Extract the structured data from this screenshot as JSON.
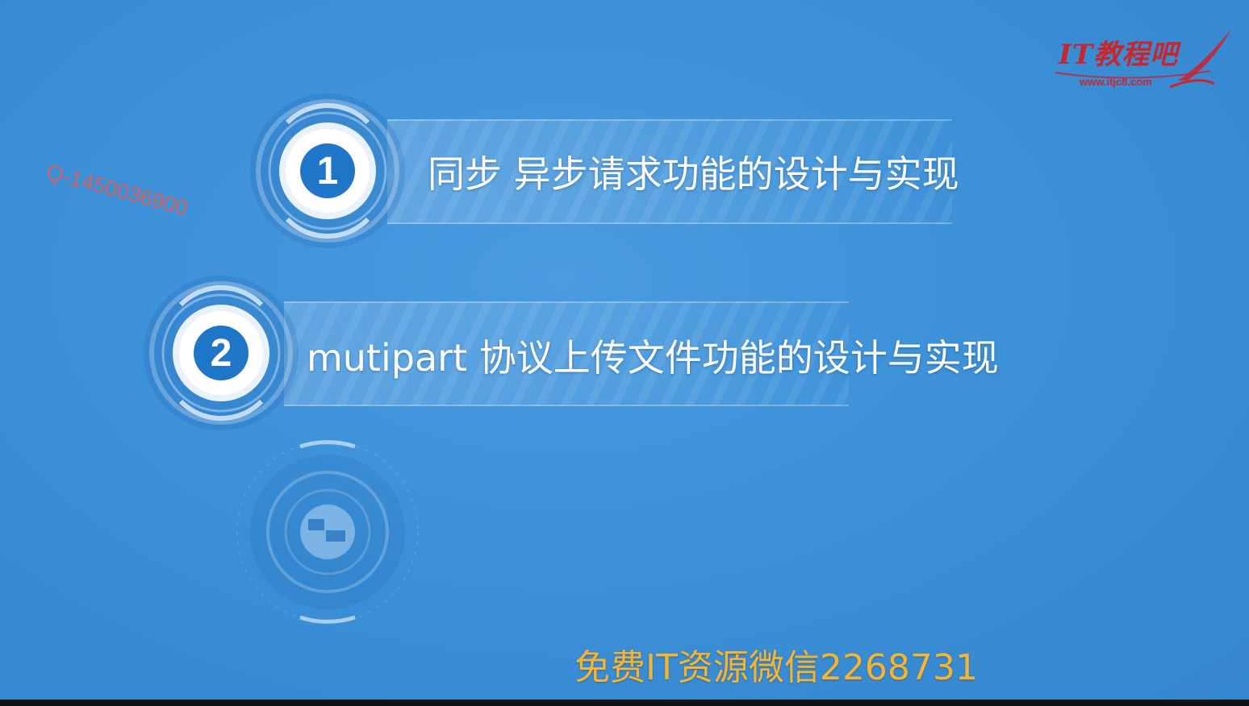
{
  "watermark": {
    "text": "Q-1450036900"
  },
  "logo": {
    "title": "IT教程吧",
    "url": "www.itjc8.com"
  },
  "items": [
    {
      "number": "1",
      "text": "同步 异步请求功能的设计与实现"
    },
    {
      "number": "2",
      "text": "mutipart 协议上传文件功能的设计与实现"
    }
  ],
  "footer": {
    "text": "免费IT资源微信2268731"
  },
  "colors": {
    "background": "#3a8fd6",
    "badge": "#1f76c9",
    "footer_text": "#f5b531",
    "logo": "#c9252c",
    "watermark": "#e15f55"
  }
}
